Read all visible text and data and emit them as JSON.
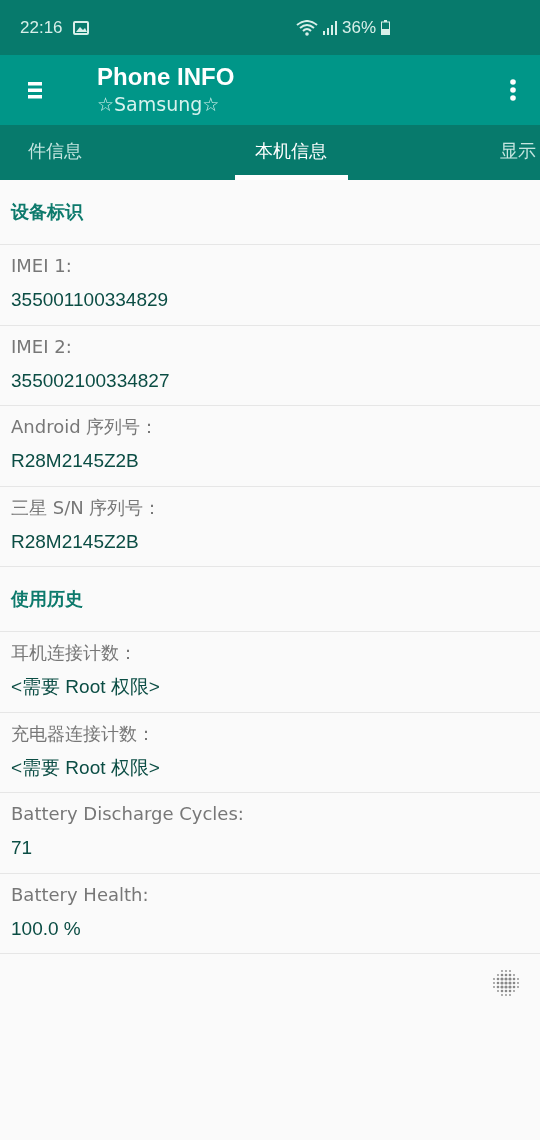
{
  "status_bar": {
    "time": "22:16",
    "battery": "36%"
  },
  "app_bar": {
    "title": "Phone INFO",
    "subtitle": "☆Samsung☆"
  },
  "tabs": [
    {
      "label": "件信息",
      "selected": false
    },
    {
      "label": "本机信息",
      "selected": true
    },
    {
      "label": "显示",
      "selected": false
    }
  ],
  "sections": [
    {
      "title": "设备标识",
      "items": [
        {
          "label": "IMEI 1:",
          "value": "355001100334829"
        },
        {
          "label": "IMEI 2:",
          "value": "355002100334827"
        },
        {
          "label": "Android 序列号：",
          "value": "R28M2145Z2B"
        },
        {
          "label": "三星 S/N 序列号：",
          "value": "R28M2145Z2B"
        }
      ]
    },
    {
      "title": "使用历史",
      "items": [
        {
          "label": "耳机连接计数：",
          "value": "<需要 Root 权限>"
        },
        {
          "label": "充电器连接计数：",
          "value": "<需要 Root 权限>"
        },
        {
          "label": "Battery Discharge Cycles:",
          "value": "71"
        },
        {
          "label": "Battery Health:",
          "value": "100.0 %"
        }
      ]
    }
  ]
}
